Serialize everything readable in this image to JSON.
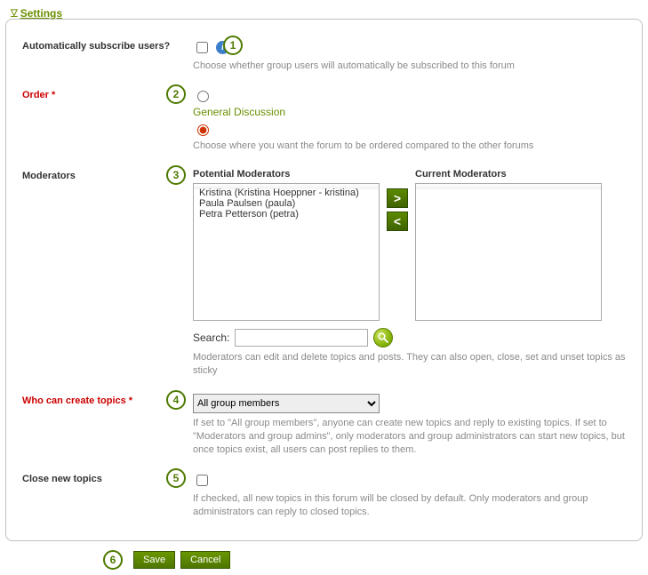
{
  "header": {
    "title": "Settings"
  },
  "badges": {
    "b1": "1",
    "b2": "2",
    "b3": "3",
    "b4": "4",
    "b5": "5",
    "b6": "6"
  },
  "autosub": {
    "label": "Automatically subscribe users?",
    "help": "Choose whether group users will automatically be subscribed to this forum"
  },
  "order": {
    "label": "Order *",
    "option_label": "General Discussion",
    "help": "Choose where you want the forum to be ordered compared to the other forums"
  },
  "moderators": {
    "label": "Moderators",
    "potential_title": "Potential Moderators",
    "current_title": "Current Moderators",
    "potential_list": [
      "Kristina (Kristina Hoeppner - kristina)",
      "Paula Paulsen (paula)",
      "Petra Petterson (petra)"
    ],
    "search_label": "Search:",
    "help": "Moderators can edit and delete topics and posts. They can also open, close, set and unset topics as sticky"
  },
  "create": {
    "label": "Who can create topics *",
    "selected": "All group members",
    "help": "If set to \"All group members\", anyone can create new topics and reply to existing topics. If set to \"Moderators and group admins\", only moderators and group administrators can start new topics, but once topics exist, all users can post replies to them."
  },
  "close": {
    "label": "Close new topics",
    "help": "If checked, all new topics in this forum will be closed by default. Only moderators and group administrators can reply to closed topics."
  },
  "buttons": {
    "save": "Save",
    "cancel": "Cancel"
  },
  "mover": {
    "right": ">",
    "left": "<"
  }
}
